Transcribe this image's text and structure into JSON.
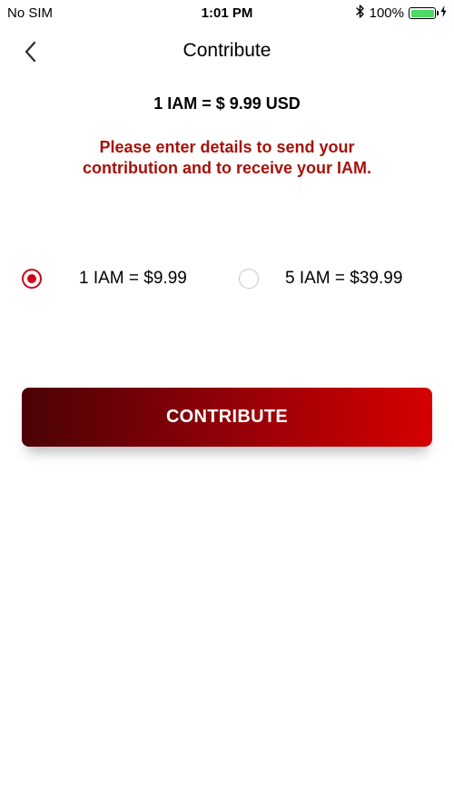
{
  "status_bar": {
    "carrier": "No SIM",
    "time": "1:01 PM",
    "battery_percent": "100%",
    "battery_level": 1.0,
    "icons": [
      "bluetooth-icon",
      "battery-icon",
      "charging-icon"
    ]
  },
  "header": {
    "title": "Contribute",
    "back_icon": "chevron-left-icon"
  },
  "rate": "1 IAM = $ 9.99 USD",
  "message": "Please enter details to send your contribution and to receive your IAM.",
  "options": [
    {
      "label": "1 IAM = $9.99",
      "selected": true
    },
    {
      "label": "5 IAM = $39.99",
      "selected": false
    }
  ],
  "contribute_button": {
    "label": "CONTRIBUTE"
  },
  "colors": {
    "accent": "#d0011b",
    "message": "#a5120b",
    "button_gradient_start": "#4a0205",
    "button_gradient_end": "#d50000",
    "battery": "#4cd964"
  }
}
